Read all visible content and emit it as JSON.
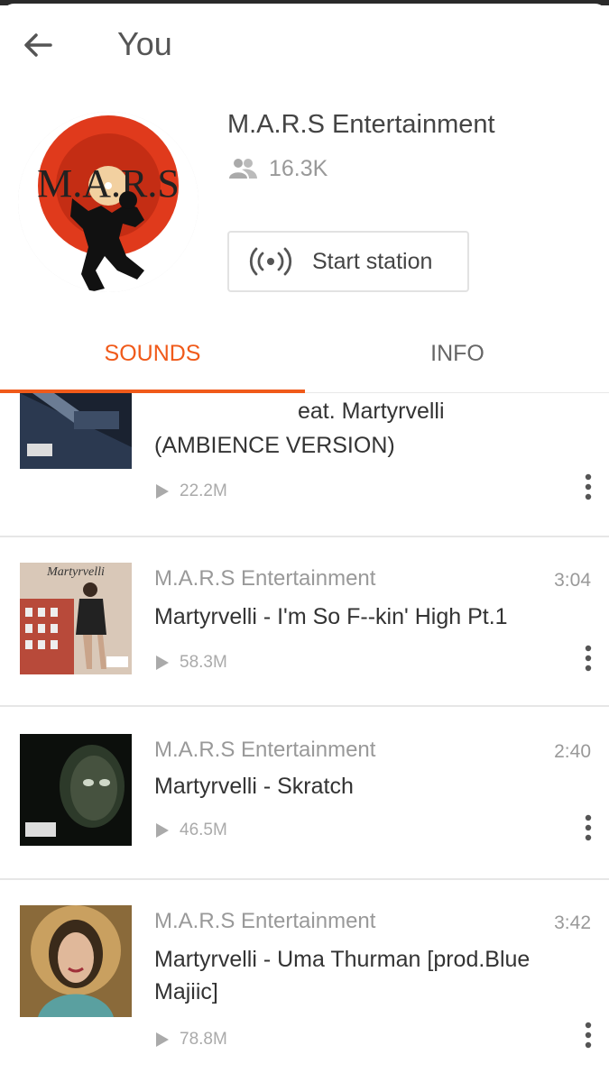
{
  "app": {
    "title": "You"
  },
  "profile": {
    "name": "M.A.R.S Entertainment",
    "followers": "16.3K",
    "avatar_text": "M.A.R.S",
    "station_button": "Start station"
  },
  "tabs": [
    {
      "label": "SOUNDS",
      "active": true
    },
    {
      "label": "INFO",
      "active": false
    }
  ],
  "tracks": [
    {
      "title_line1": "eat. Martyrvelli",
      "title_line2": "(AMBIENCE VERSION)",
      "plays": "22.2M"
    },
    {
      "artist": "M.A.R.S Entertainment",
      "duration": "3:04",
      "title": "Martyrvelli - I'm So F--kin' High Pt.1",
      "plays": "58.3M",
      "art_text": "Martyrvelli"
    },
    {
      "artist": "M.A.R.S Entertainment",
      "duration": "2:40",
      "title": "Martyrvelli - Skratch",
      "plays": "46.5M"
    },
    {
      "artist": "M.A.R.S Entertainment",
      "duration": "3:42",
      "title": "Martyrvelli - Uma Thurman [prod.Blue Majiic]",
      "plays": "78.8M"
    }
  ],
  "colors": {
    "accent": "#f05a1a",
    "text_primary": "#333333",
    "text_secondary": "#999999"
  },
  "icons": {
    "back": "arrow-left-icon",
    "followers": "people-icon",
    "station": "radio-broadcast-icon",
    "play": "play-icon",
    "more": "more-vertical-icon"
  }
}
